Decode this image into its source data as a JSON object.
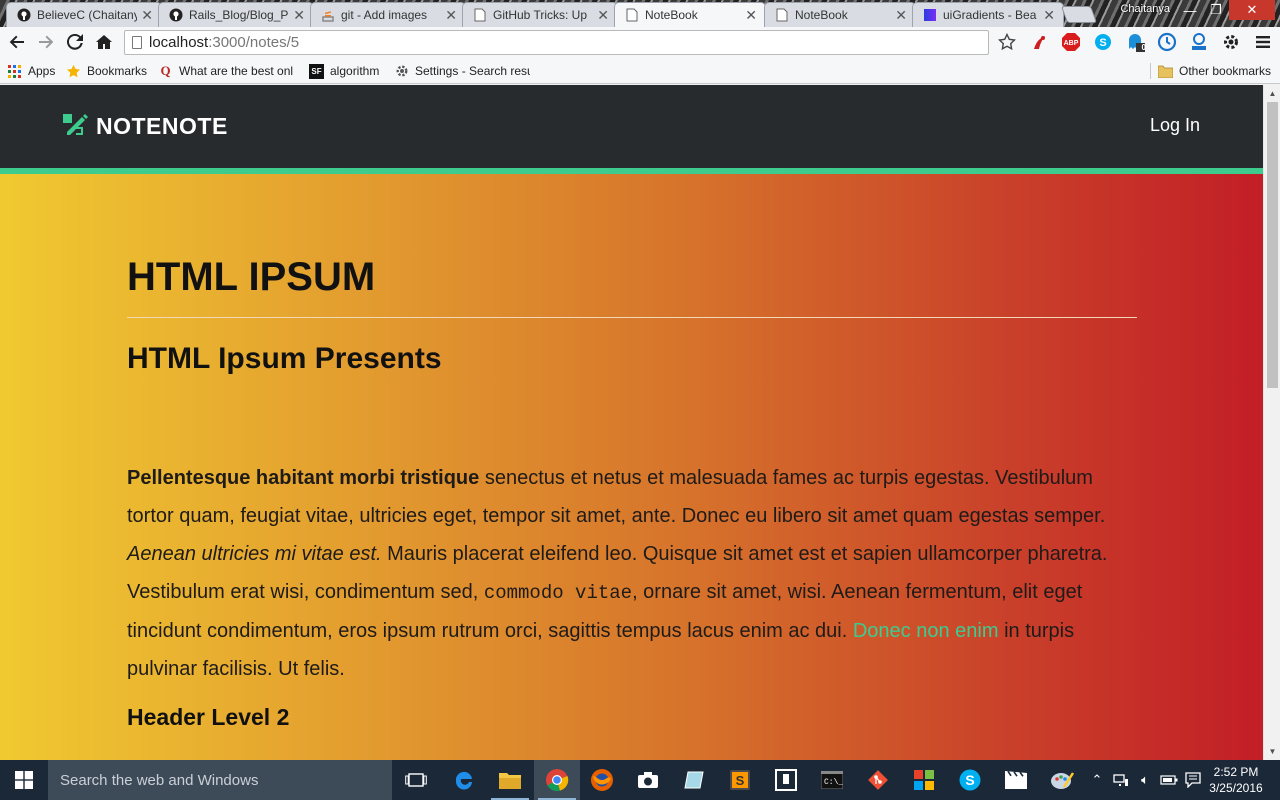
{
  "browser": {
    "tabs": [
      {
        "title": "BelieveC (Chaitanya",
        "icon": "github-icon"
      },
      {
        "title": "Rails_Blog/Blog_P",
        "icon": "github-icon"
      },
      {
        "title": "git - Add images",
        "icon": "stackoverflow-icon"
      },
      {
        "title": "GitHub Tricks: Up",
        "icon": "page-icon"
      },
      {
        "title": "NoteBook",
        "icon": "page-icon",
        "active": true
      },
      {
        "title": "NoteBook",
        "icon": "page-icon"
      },
      {
        "title": "uiGradients - Bea",
        "icon": "uigradients-icon"
      }
    ],
    "profile_name": "Chaitanya",
    "url_host": "localhost",
    "url_path": ":3000/notes/5",
    "bookmarks": [
      {
        "label": "Apps",
        "icon": "apps-grid-icon"
      },
      {
        "label": "Bookmarks",
        "icon": "star-icon"
      },
      {
        "label": "What are the best onl",
        "icon": "quora-icon"
      },
      {
        "label": "algorithm",
        "icon": "sf-icon"
      },
      {
        "label": "Settings - Search resu",
        "icon": "gear-icon"
      }
    ],
    "other_bookmarks": "Other bookmarks",
    "extension_badge": "0"
  },
  "site": {
    "brand": "NOTENOTE",
    "login": "Log In",
    "colors": {
      "accent": "#3dcc8e",
      "navbar": "#272b2e",
      "gradient_start": "#f0c930",
      "gradient_end": "#c21e26"
    }
  },
  "note": {
    "title": "HTML IPSUM",
    "subtitle": "HTML Ipsum Presents",
    "paragraph": {
      "bold": "Pellentesque habitant morbi tristique",
      "text1": " senectus et netus et malesuada fames ac turpis egestas. Vestibulum tortor quam, feugiat vitae, ultricies eget, tempor sit amet, ante. Donec eu libero sit amet quam egestas semper. ",
      "italic": "Aenean ultricies mi vitae est.",
      "text2": " Mauris placerat eleifend leo. Quisque sit amet est et sapien ullamcorper pharetra. Vestibulum erat wisi, condimentum sed, ",
      "code": "commodo vitae",
      "text3": ", ornare sit amet, wisi. Aenean fermentum, elit eget tincidunt condimentum, eros ipsum rutrum orci, sagittis tempus lacus enim ac dui. ",
      "link": "Donec non enim",
      "text4": " in turpis pulvinar facilisis. Ut felis."
    },
    "heading2": "Header Level 2"
  },
  "taskbar": {
    "search_placeholder": "Search the web and Windows",
    "time": "2:52 PM",
    "date": "3/25/2016"
  }
}
